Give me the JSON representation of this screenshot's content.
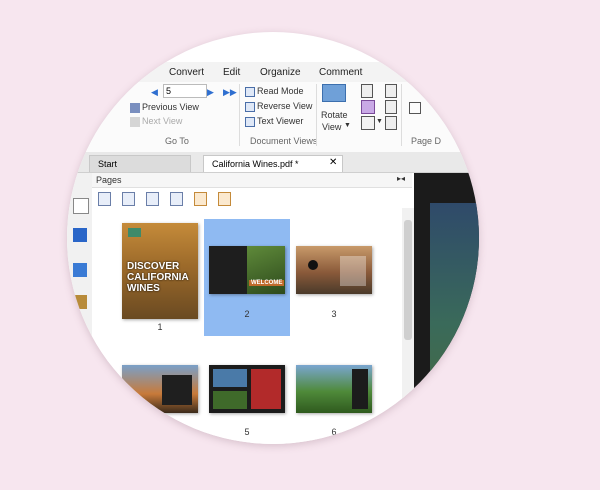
{
  "menu": [
    "Convert",
    "Edit",
    "Organize",
    "Comment"
  ],
  "ribbon": {
    "page_value": "5",
    "previous_view": "Previous View",
    "next_view": "Next View",
    "goto_group": "Go To",
    "read_mode": "Read Mode",
    "reverse_view": "Reverse View",
    "text_viewer": "Text Viewer",
    "document_views_group": "Document Views",
    "rotate_view_line1": "Rotate",
    "rotate_view_line2": "View",
    "page_display_group": "Page D"
  },
  "tabs": {
    "start": "Start",
    "active": "California Wines.pdf *"
  },
  "panel": {
    "title": "Pages"
  },
  "pages": [
    {
      "num": "1",
      "headline": "DISCOVER CALIFORNIA WINES"
    },
    {
      "num": "2",
      "headline": "WELCOME"
    },
    {
      "num": "3",
      "headline": ""
    },
    {
      "num": "",
      "headline": ""
    },
    {
      "num": "5",
      "headline": ""
    },
    {
      "num": "6",
      "headline": ""
    }
  ],
  "colors": {
    "selection": "#8fbaf2",
    "background": "#f7e6ef"
  }
}
